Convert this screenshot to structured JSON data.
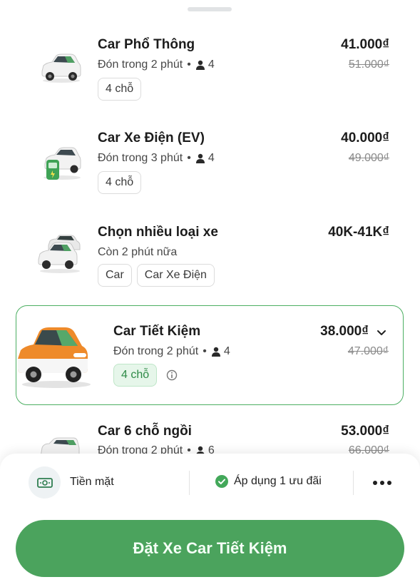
{
  "colors": {
    "accent": "#4ba35d",
    "selected_border": "#4caf62",
    "chip_green_bg": "#e6f6ea"
  },
  "options": [
    {
      "title": "Car Phổ Thông",
      "eta": "Đón trong 2 phút",
      "seats": "4",
      "price": "41.000₫",
      "old_price": "51.000₫",
      "chips": [
        "4 chỗ"
      ],
      "icon": "white-car-icon"
    },
    {
      "title": "Car Xe Điện (EV)",
      "eta": "Đón trong 3 phút",
      "seats": "4",
      "price": "40.000₫",
      "old_price": "49.000₫",
      "chips": [
        "4 chỗ"
      ],
      "icon": "ev-car-icon"
    },
    {
      "title": "Chọn nhiều loại xe",
      "eta": "Còn 2 phút nữa",
      "price": "40K-41K₫",
      "chips": [
        "Car",
        "Car Xe Điện"
      ],
      "icon": "multi-car-icon"
    },
    {
      "title": "Car Tiết Kiệm",
      "eta": "Đón trong 2 phút",
      "seats": "4",
      "price": "38.000₫",
      "old_price": "47.000₫",
      "chips": [
        "4 chỗ"
      ],
      "icon": "orange-car-icon",
      "selected": true
    },
    {
      "title": "Car 6 chỗ ngồi",
      "eta": "Đón trong 2 phút",
      "seats": "6",
      "price": "53.000₫",
      "old_price": "66.000₫",
      "icon": "white-van-icon"
    }
  ],
  "payment": {
    "label": "Tiền mặt",
    "icon": "cash-icon"
  },
  "promo": {
    "label": "Áp dụng 1 ưu đãi",
    "icon": "check-circle-icon"
  },
  "more": {
    "icon": "more-dots-icon"
  },
  "book_button": {
    "label": "Đặt Xe Car Tiết Kiệm"
  }
}
